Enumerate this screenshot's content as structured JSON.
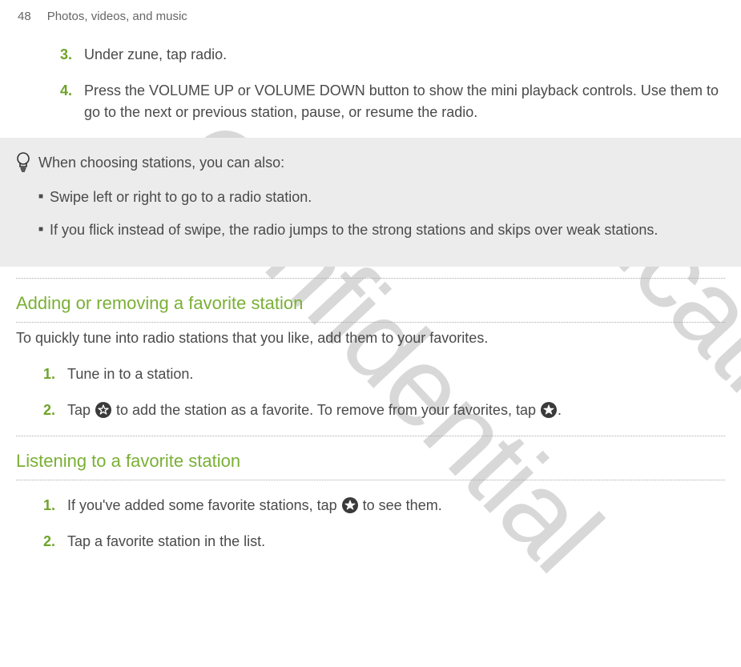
{
  "page": {
    "number": "48",
    "chapter": "Photos, videos, and music"
  },
  "steps_intro": [
    {
      "num": "3.",
      "text": "Under zune, tap radio."
    },
    {
      "num": "4.",
      "text": "Press the VOLUME UP or VOLUME DOWN button to show the mini playback controls. Use them to go to the next or previous station, pause, or resume the radio."
    }
  ],
  "tip": {
    "intro": "When choosing stations, you can also:",
    "items": [
      "Swipe left or right to go to a radio station.",
      "If you flick instead of swipe, the radio jumps to the strong stations and skips over weak stations."
    ]
  },
  "section_fav": {
    "title": "Adding or removing a favorite station",
    "intro": "To quickly tune into radio stations that you like, add them to your favorites.",
    "steps": [
      {
        "num": "1.",
        "text": "Tune in to a station."
      },
      {
        "num": "2.",
        "before": "Tap ",
        "mid": " to add the station as a favorite. To remove from your favorites, tap ",
        "after": "."
      }
    ]
  },
  "section_listen": {
    "title": "Listening to a favorite station",
    "steps": [
      {
        "num": "1.",
        "before": "If you've added some favorite stations, tap ",
        "after": " to see them."
      },
      {
        "num": "2.",
        "text": "Tap a favorite station in the list."
      }
    ]
  },
  "watermarks": {
    "w1": "Confidential",
    "w2": "ification only"
  }
}
